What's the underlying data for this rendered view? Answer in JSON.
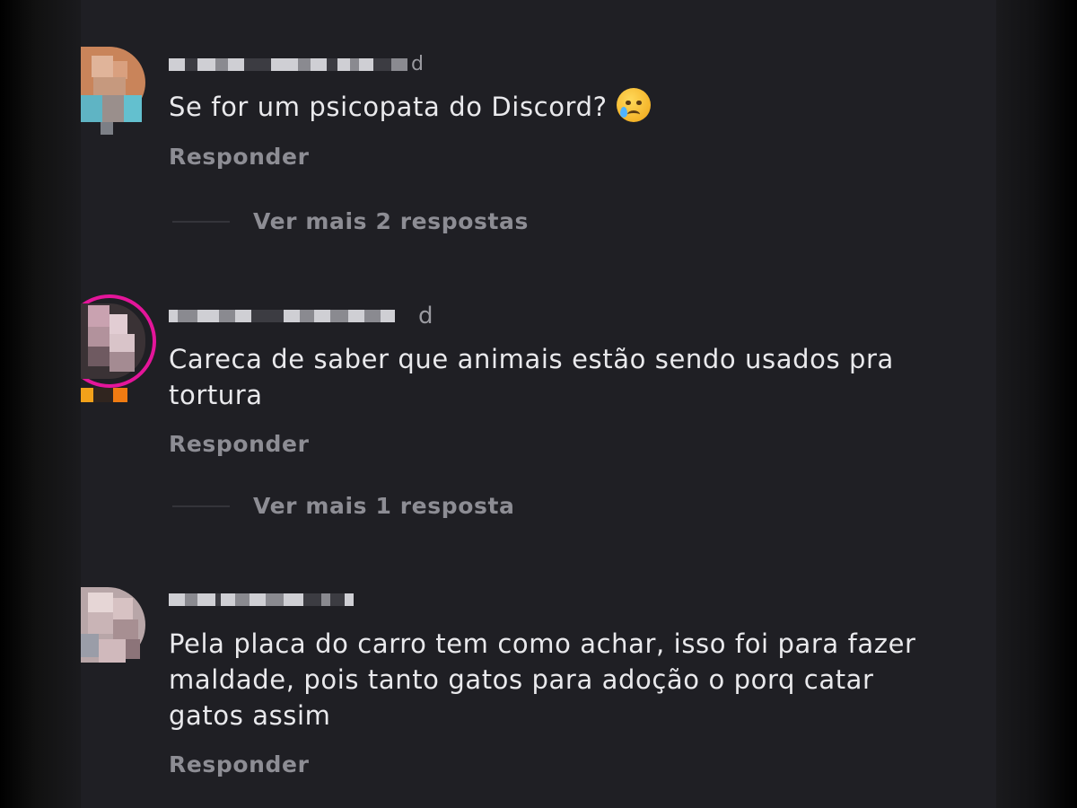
{
  "comments": [
    {
      "time": "d",
      "text": "Se for um psicopata do Discord?",
      "emoji": "crying-face-emoji",
      "reply_label": "Responder",
      "more_replies": "Ver mais 2 respostas"
    },
    {
      "time": "d",
      "text": "Careca de saber que animais estão sendo usados pra tortura",
      "reply_label": "Responder",
      "more_replies": "Ver mais 1 resposta"
    },
    {
      "text": "Pela placa do carro tem como achar, isso foi para fazer maldade, pois tanto gatos para adoção o porq catar gatos assim",
      "reply_label": "Responder"
    }
  ],
  "colors": {
    "background": "#1f1f24",
    "text": "#e9e9ec",
    "muted": "#8d8d94",
    "story_ring": "#e4159a"
  }
}
